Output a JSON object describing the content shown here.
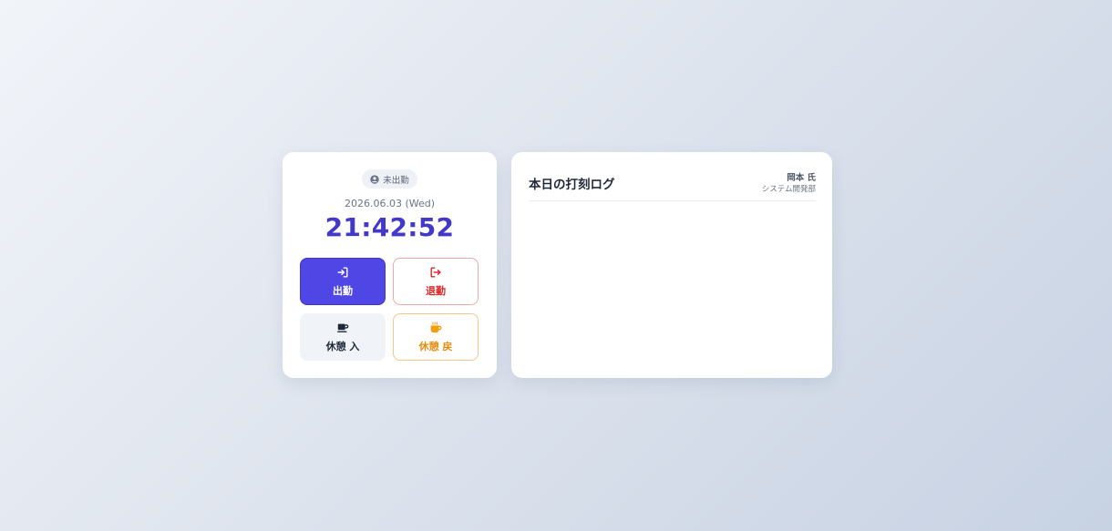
{
  "clock": {
    "status_label": "未出勤",
    "date": "2026.06.03 (Wed)",
    "time": "21:42:52",
    "accent_color": "#4338ca"
  },
  "buttons": {
    "clock_in": {
      "label": "出勤",
      "icon": "sign-in-icon"
    },
    "clock_out": {
      "label": "退勤",
      "icon": "sign-out-icon"
    },
    "break_start": {
      "label": "休憩 入",
      "icon": "mug-icon"
    },
    "break_end": {
      "label": "休憩 戻",
      "icon": "coffee-icon"
    }
  },
  "log": {
    "title": "本日の打刻ログ",
    "user_name": "岡本 氏",
    "department": "システム開発部",
    "entries": []
  }
}
